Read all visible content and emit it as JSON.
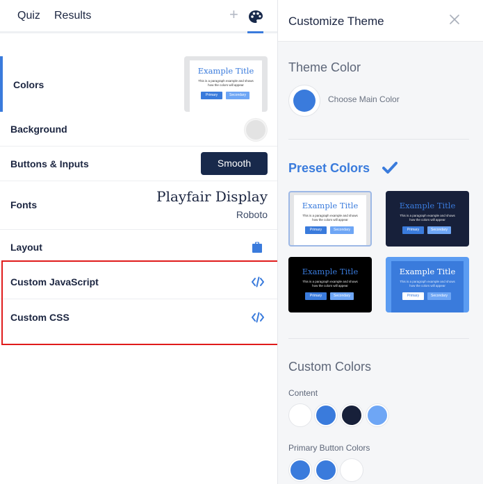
{
  "tabs": {
    "quiz": "Quiz",
    "results": "Results",
    "plus": "+"
  },
  "left": {
    "colors_label": "Colors",
    "background_label": "Background",
    "buttons_label": "Buttons & Inputs",
    "buttons_style": "Smooth",
    "fonts_label": "Fonts",
    "font_primary": "Playfair Display",
    "font_secondary": "Roboto",
    "layout_label": "Layout",
    "custom_js_label": "Custom JavaScript",
    "custom_css_label": "Custom CSS",
    "background_color": "#e3e3e3"
  },
  "preview": {
    "title": "Example Title",
    "text": "This is a paragraph example and shows how the colors will appear",
    "primary": "Primary",
    "secondary": "Secondary"
  },
  "right": {
    "header_title": "Customize Theme",
    "theme_color_title": "Theme Color",
    "choose_main_color": "Choose Main Color",
    "main_color": "#3a7bdc",
    "preset_colors_title": "Preset Colors",
    "custom_colors_title": "Custom Colors",
    "content_label": "Content",
    "primary_button_label": "Primary Button Colors",
    "content_swatches": [
      "#ffffff",
      "#3a7bdc",
      "#17203a",
      "#6ea6f5"
    ],
    "primary_button_swatches": [
      "#3a7bdc",
      "#3a7bdc",
      "#ffffff"
    ]
  },
  "colors": {
    "accent": "#3a7bdc",
    "navy": "#18294b",
    "highlight": "#e01b1b"
  }
}
